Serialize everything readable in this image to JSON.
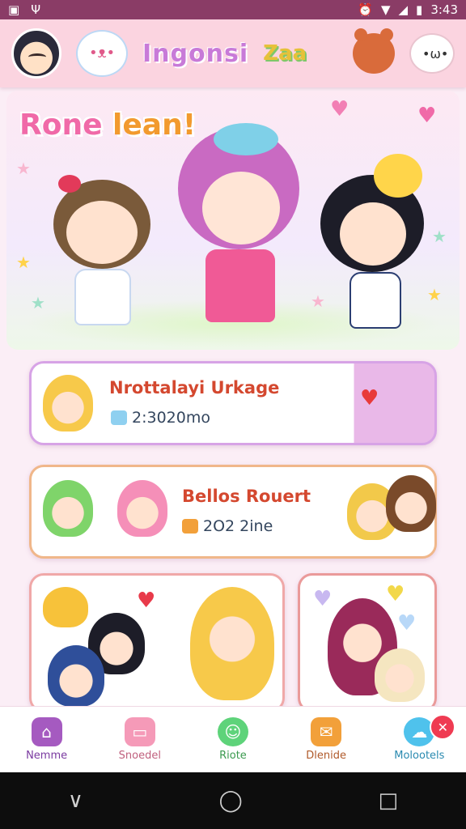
{
  "status_bar": {
    "time": "3:43",
    "icons": [
      "screenshot-icon",
      "usb-icon",
      "alarm-icon",
      "wifi-icon",
      "signal-icon",
      "battery-icon"
    ]
  },
  "header": {
    "title": "Ingonsi",
    "logo_text": "Zaa"
  },
  "hero": {
    "title_part1": "Rone ",
    "title_part2": "lean!"
  },
  "cards": [
    {
      "title": "Nrottalayi Urkage",
      "subtitle": "2:3020mo"
    },
    {
      "title": "Bellos Rouert",
      "subtitle": "2O2 2ine"
    }
  ],
  "bottom_nav": [
    {
      "label": "Nemme",
      "icon": "home-icon",
      "color": "#a55ac0",
      "text_color": "#7a3aa0"
    },
    {
      "label": "Snoedel",
      "icon": "card-icon",
      "color": "#f59ab8",
      "text_color": "#c0607e"
    },
    {
      "label": "Riote",
      "icon": "chat-bubble-icon",
      "color": "#5ed37a",
      "text_color": "#3a9a4e"
    },
    {
      "label": "Dlenide",
      "icon": "gift-icon",
      "color": "#f2a03a",
      "text_color": "#b05a2a"
    },
    {
      "label": "Molootels",
      "icon": "message-icon",
      "color": "#4fc2ec",
      "text_color": "#2a8ab0",
      "badge": "✕"
    }
  ],
  "system_nav": {
    "back": "∨",
    "home": "◯",
    "recents": "□"
  },
  "colors": {
    "status_bar": "#8a3c66",
    "header": "#fbd4e0",
    "accent_pink": "#f06aa8",
    "card_title": "#d4482f"
  }
}
